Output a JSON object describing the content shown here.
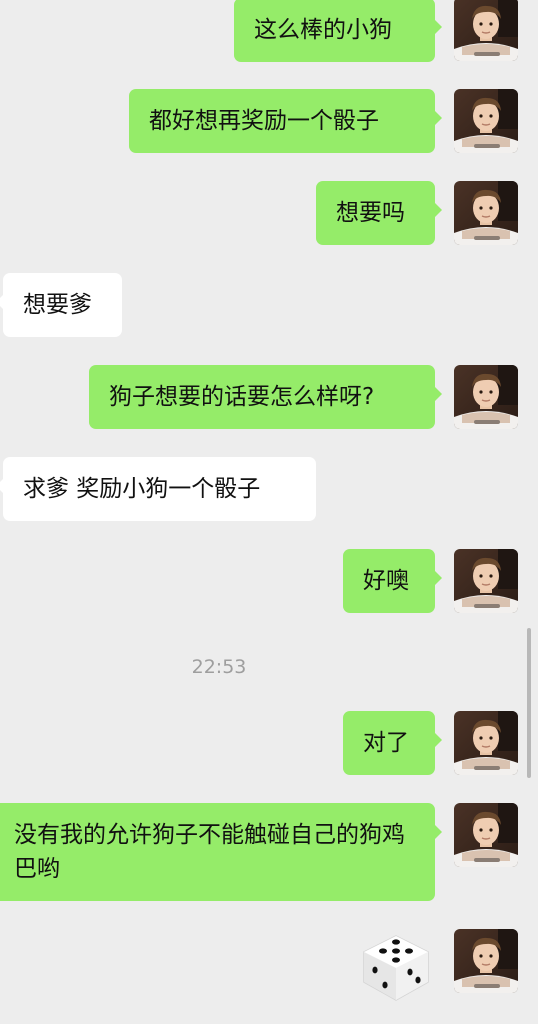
{
  "messages": [
    {
      "text": "这么棒的小狗"
    },
    {
      "text": "都好想再奖励一个骰子"
    },
    {
      "text": "想要吗"
    },
    {
      "text": "想要爹"
    },
    {
      "text": "狗子想要的话要怎么样呀?"
    },
    {
      "text": "求爹 奖励小狗一个骰子"
    },
    {
      "text": "好噢"
    },
    {
      "text": "对了"
    },
    {
      "text": "没有我的允许狗子不能触碰自己的狗鸡巴哟"
    }
  ],
  "timestamp": "22:53",
  "colors": {
    "background": "#ededed",
    "outgoing_bubble": "#95ec69",
    "incoming_bubble": "#ffffff",
    "timestamp": "#9e9e9e"
  },
  "icons": {
    "avatar": "boy-avatar-photo",
    "dice": "dice-sticker"
  },
  "dice_face": 5
}
